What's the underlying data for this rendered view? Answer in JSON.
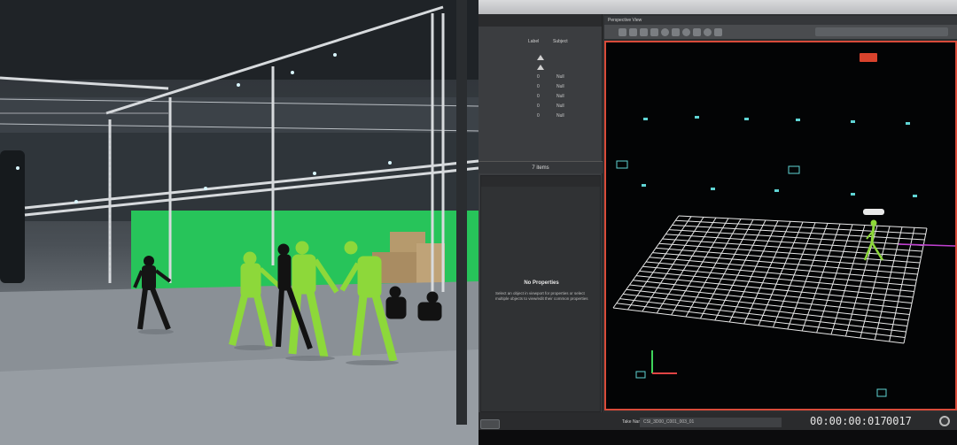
{
  "monitor": {
    "viewport_title": "Perspective View",
    "tracker_columns": [
      "Label",
      "Subject"
    ],
    "tracker_values": [
      "Null",
      "Null",
      "Null",
      "Null",
      "Null"
    ],
    "frames_label": "7 items",
    "properties_title": "No Properties",
    "properties_desc": "Select an object in viewport for properties or select multiple objects to view/edit their common properties",
    "take_label": "Take Name:",
    "take_name": "CSI_3D00_C001_003_01",
    "timecode": "00:00:00:017",
    "frame_count": "0017",
    "accent_color": "#d84b3a",
    "grid_color": "#e8e8e8",
    "marker_color": "#5fd4d4"
  },
  "stage": {
    "screen_color": "#27c45a",
    "suit_color": "#8dd83a"
  }
}
